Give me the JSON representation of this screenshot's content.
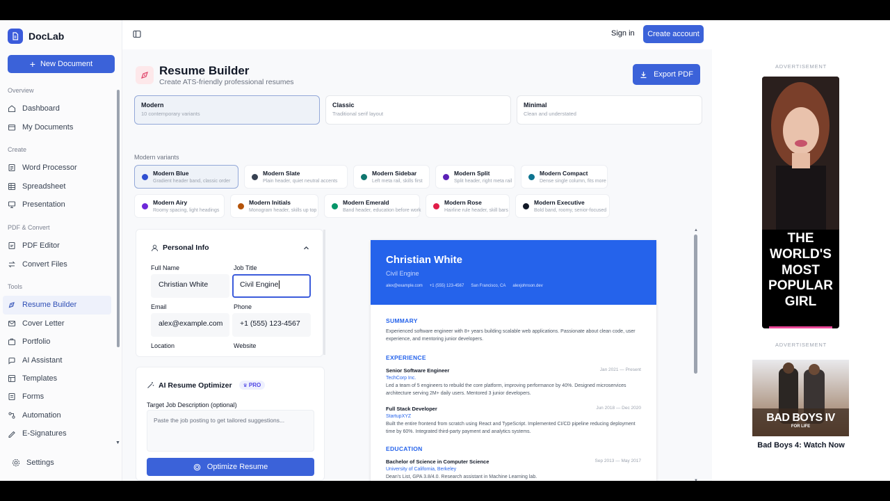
{
  "app": {
    "name": "DocLab",
    "new_document": "New Document"
  },
  "nav": {
    "groups": [
      {
        "label": "Overview",
        "items": [
          "Dashboard",
          "My Documents"
        ]
      },
      {
        "label": "Create",
        "items": [
          "Word Processor",
          "Spreadsheet",
          "Presentation"
        ]
      },
      {
        "label": "PDF & Convert",
        "items": [
          "PDF Editor",
          "Convert Files"
        ]
      },
      {
        "label": "Tools",
        "items": [
          "Resume Builder",
          "Cover Letter",
          "Portfolio",
          "AI Assistant",
          "Templates",
          "Forms",
          "Automation",
          "E-Signatures"
        ]
      }
    ],
    "active": "Resume Builder",
    "settings": "Settings"
  },
  "topbar": {
    "sign_in": "Sign in",
    "create_account": "Create account"
  },
  "page": {
    "title": "Resume Builder",
    "subtitle": "Create ATS-friendly professional resumes",
    "export": "Export PDF"
  },
  "styles": [
    {
      "name": "Modern",
      "desc": "10 contemporary variants",
      "selected": true
    },
    {
      "name": "Classic",
      "desc": "Traditional serif layout",
      "selected": false
    },
    {
      "name": "Minimal",
      "desc": "Clean and understated",
      "selected": false
    }
  ],
  "variants_label": "Modern variants",
  "variants": [
    {
      "name": "Modern Blue",
      "desc": "Gradient header band, classic order",
      "color": "#2f4fd1",
      "selected": true
    },
    {
      "name": "Modern Slate",
      "desc": "Plain header, quiet neutral accents",
      "color": "#374151"
    },
    {
      "name": "Modern Sidebar",
      "desc": "Left meta rail, skills first",
      "color": "#0f766e"
    },
    {
      "name": "Modern Split",
      "desc": "Split header, right meta rail",
      "color": "#5b21b6"
    },
    {
      "name": "Modern Compact",
      "desc": "Dense single column, fits more",
      "color": "#0e7490"
    },
    {
      "name": "Modern Airy",
      "desc": "Roomy spacing, light headings",
      "color": "#6d28d9"
    },
    {
      "name": "Modern Initials",
      "desc": "Monogram header, skills up top",
      "color": "#b45309"
    },
    {
      "name": "Modern Emerald",
      "desc": "Band header, education before work",
      "color": "#059669"
    },
    {
      "name": "Modern Rose",
      "desc": "Hairline rule header, skill bars",
      "color": "#e11d48"
    },
    {
      "name": "Modern Executive",
      "desc": "Bold band, roomy, senior-focused",
      "color": "#111827"
    }
  ],
  "personal": {
    "heading": "Personal Info",
    "full_name_label": "Full Name",
    "full_name": "Christian White",
    "job_title_label": "Job Title",
    "job_title": "Civil Engine",
    "email_label": "Email",
    "email": "alex@example.com",
    "phone_label": "Phone",
    "phone": "+1 (555) 123-4567",
    "location_label": "Location",
    "website_label": "Website"
  },
  "ai": {
    "heading": "AI Resume Optimizer",
    "badge": "PRO",
    "label": "Target Job Description (optional)",
    "placeholder": "Paste the job posting to get tailored suggestions...",
    "button": "Optimize Resume"
  },
  "resume": {
    "name": "Christian White",
    "role": "Civil Engine",
    "contacts": [
      "alex@example.com",
      "+1 (555) 123-4567",
      "San Francisco, CA",
      "alexjohnson.dev"
    ],
    "summary_title": "SUMMARY",
    "summary": "Experienced software engineer with 8+ years building scalable web applications. Passionate about clean code, user experience, and mentoring junior developers.",
    "experience_title": "EXPERIENCE",
    "jobs": [
      {
        "title": "Senior Software Engineer",
        "dates": "Jan 2021 — Present",
        "org": "TechCorp Inc.",
        "desc": "Led a team of 5 engineers to rebuild the core platform, improving performance by 40%. Designed microservices architecture serving 2M+ daily users. Mentored 3 junior developers."
      },
      {
        "title": "Full Stack Developer",
        "dates": "Jun 2018 — Dec 2020",
        "org": "StartupXYZ",
        "desc": "Built the entire frontend from scratch using React and TypeScript. Implemented CI/CD pipeline reducing deployment time by 60%. Integrated third-party payment and analytics systems."
      }
    ],
    "education_title": "EDUCATION",
    "edu": {
      "degree": "Bachelor of Science in Computer Science",
      "dates": "Sep 2013 — May 2017",
      "school": "University of California, Berkeley",
      "desc": "Dean's List, GPA 3.8/4.0. Research assistant in Machine Learning lab."
    }
  },
  "ads": {
    "label": "ADVERTISEMENT",
    "ad1_text": "THE WORLD'S MOST POPULAR GIRL",
    "ad2_poster_title": "BAD BOYS IV",
    "ad2_poster_sub": "FOR LIFE",
    "ad2_title": "Bad Boys 4: Watch Now"
  }
}
